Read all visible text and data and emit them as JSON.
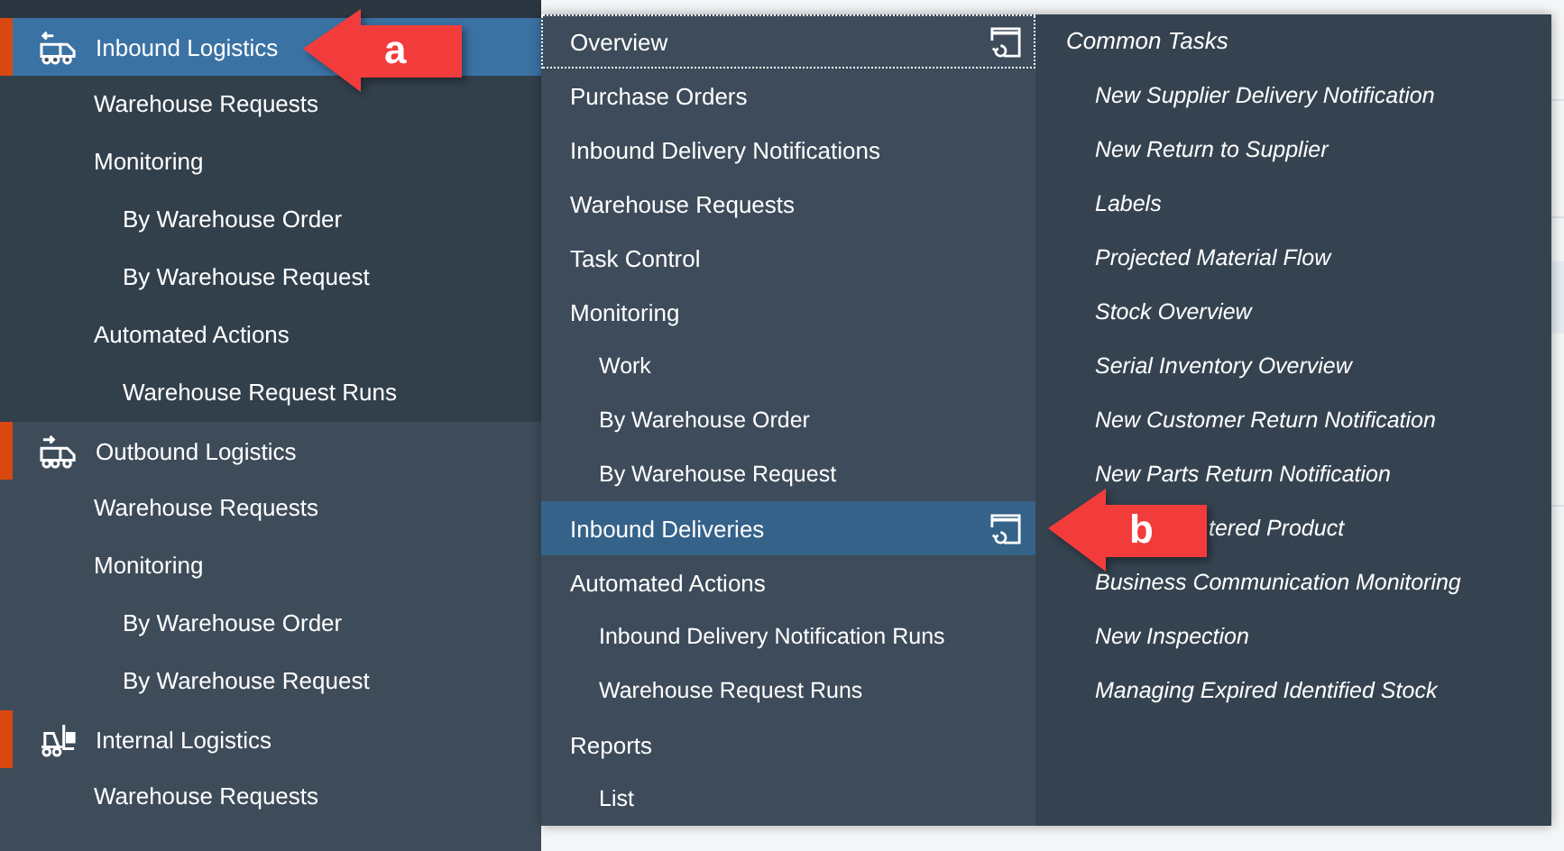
{
  "sidebar": {
    "groups": [
      {
        "label": "Inbound Logistics",
        "kind": "inbound",
        "selected": true,
        "items": [
          {
            "label": "Warehouse Requests"
          },
          {
            "label": "Monitoring",
            "children": [
              {
                "label": "By Warehouse Order"
              },
              {
                "label": "By Warehouse Request"
              }
            ]
          },
          {
            "label": "Automated Actions",
            "children": [
              {
                "label": "Warehouse Request Runs"
              }
            ]
          }
        ]
      },
      {
        "label": "Outbound Logistics",
        "kind": "outbound",
        "selected": false,
        "items": [
          {
            "label": "Warehouse Requests"
          },
          {
            "label": "Monitoring",
            "children": [
              {
                "label": "By Warehouse Order"
              },
              {
                "label": "By Warehouse Request"
              }
            ]
          }
        ]
      },
      {
        "label": "Internal Logistics",
        "kind": "internal",
        "selected": false,
        "items": [
          {
            "label": "Warehouse Requests"
          }
        ]
      }
    ]
  },
  "menu": {
    "items": [
      {
        "label": "Overview",
        "selected": false,
        "focused": true,
        "launch": true
      },
      {
        "label": "Purchase Orders",
        "selected": false,
        "focused": false,
        "launch": false
      },
      {
        "label": "Inbound Delivery Notifications",
        "selected": false,
        "focused": false,
        "launch": false
      },
      {
        "label": "Warehouse Requests",
        "selected": false,
        "focused": false,
        "launch": false
      },
      {
        "label": "Task Control",
        "selected": false,
        "focused": false,
        "launch": false
      },
      {
        "label": "Monitoring",
        "selected": false,
        "focused": false,
        "launch": false,
        "children": [
          {
            "label": "Work"
          },
          {
            "label": "By Warehouse Order"
          },
          {
            "label": "By Warehouse Request"
          }
        ]
      },
      {
        "label": "Inbound Deliveries",
        "selected": true,
        "focused": false,
        "launch": true
      },
      {
        "label": "Automated Actions",
        "selected": false,
        "focused": false,
        "launch": false,
        "children": [
          {
            "label": "Inbound Delivery Notification Runs"
          },
          {
            "label": "Warehouse Request Runs"
          }
        ]
      },
      {
        "label": "Reports",
        "selected": false,
        "focused": false,
        "launch": false,
        "children": [
          {
            "label": "List"
          }
        ]
      }
    ],
    "common_tasks": {
      "title": "Common Tasks",
      "items": [
        {
          "label": "New Supplier Delivery Notification",
          "kind": "full"
        },
        {
          "label": "New Return to Supplier",
          "kind": "full"
        },
        {
          "label": "Labels",
          "kind": "full"
        },
        {
          "label": "Projected Material Flow",
          "kind": "full"
        },
        {
          "label": "Stock Overview",
          "kind": "full"
        },
        {
          "label": "Serial Inventory Overview",
          "kind": "full"
        },
        {
          "label": "New Customer Return Notification",
          "kind": "full"
        },
        {
          "label": "New Parts Return Notification",
          "kind": "full"
        },
        {
          "label": "tered Product",
          "kind": "covered"
        },
        {
          "label": "Business Communication Monitoring",
          "kind": "full"
        },
        {
          "label": "New Inspection",
          "kind": "full"
        },
        {
          "label": "Managing Expired Identified Stock",
          "kind": "full"
        }
      ]
    }
  },
  "callouts": [
    {
      "label": "a"
    },
    {
      "label": "b"
    }
  ]
}
